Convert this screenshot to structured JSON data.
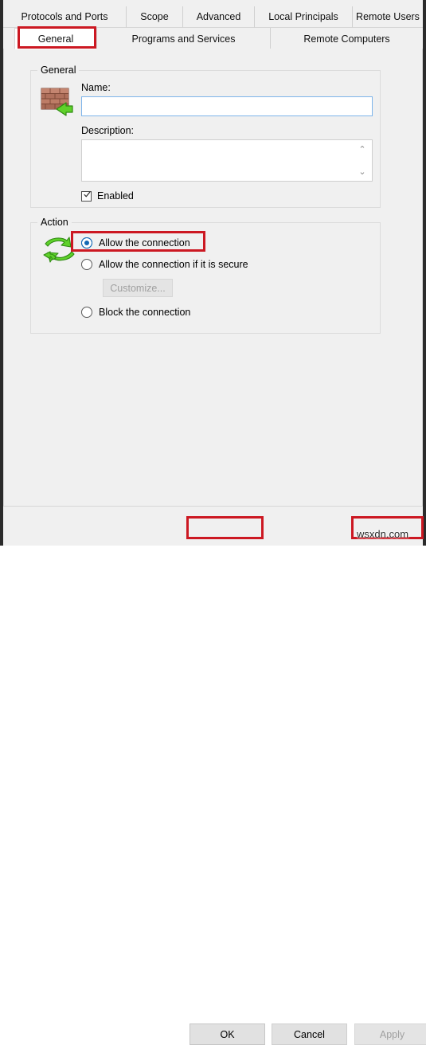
{
  "dialog": {
    "tabs_row1": [
      {
        "label": "Protocols and Ports",
        "selected": false
      },
      {
        "label": "Scope",
        "selected": false
      },
      {
        "label": "Advanced",
        "selected": false
      },
      {
        "label": "Local Principals",
        "selected": false
      },
      {
        "label": "Remote Users",
        "selected": false
      }
    ],
    "tabs_row2": [
      {
        "label": "General",
        "selected": true
      },
      {
        "label": "Programs and Services",
        "selected": false
      },
      {
        "label": "Remote Computers",
        "selected": false
      }
    ]
  },
  "general_group": {
    "title": "General",
    "icon": "firewall-brick-wall-icon",
    "name_label": "Name:",
    "name_value": "",
    "name_placeholder": "",
    "description_label": "Description:",
    "description_value": "",
    "description_placeholder": "",
    "scroll_up_glyph": "⌃",
    "scroll_down_glyph": "⌄",
    "enabled_label": "Enabled",
    "enabled_checked": true
  },
  "action_group": {
    "title": "Action",
    "icon": "green-circular-arrows-icon",
    "options": [
      {
        "label": "Allow the connection",
        "selected": true
      },
      {
        "label": "Allow the connection if it is secure",
        "selected": false
      },
      {
        "label": "Block the connection",
        "selected": false
      }
    ],
    "customize_label": "Customize...",
    "customize_enabled": false
  },
  "footer": {
    "ok_label": "OK",
    "cancel_label": "Cancel",
    "apply_label": "Apply",
    "apply_enabled": false
  },
  "annotations": {
    "highlight_color": "#cc1822",
    "watermark": "wsxdn.com"
  }
}
